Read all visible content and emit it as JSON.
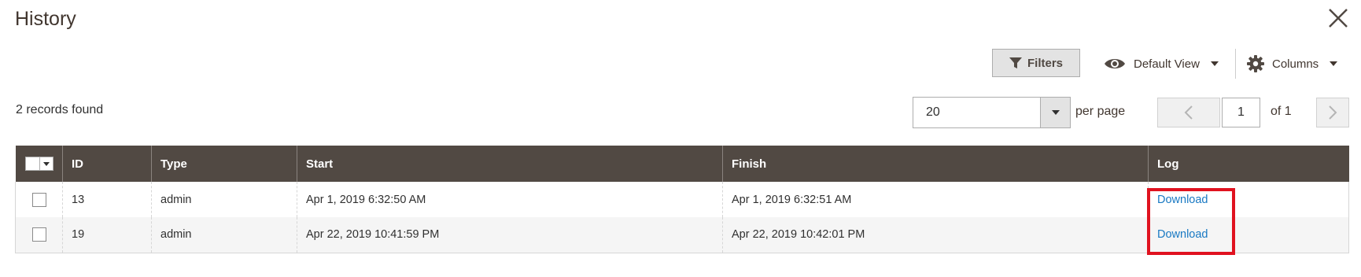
{
  "modal": {
    "title": "History"
  },
  "toolbar": {
    "filters_label": "Filters",
    "view_label": "Default View",
    "columns_label": "Columns"
  },
  "summary": {
    "records_text": "2 records found"
  },
  "pagination": {
    "per_page_value": "20",
    "per_page_label": "per page",
    "current_page": "1",
    "of_text": "of 1"
  },
  "grid": {
    "columns": [
      "ID",
      "Type",
      "Start",
      "Finish",
      "Log"
    ],
    "rows": [
      {
        "id": "13",
        "type": "admin",
        "start": "Apr 1, 2019 6:32:50 AM",
        "finish": "Apr 1, 2019 6:32:51 AM",
        "log": "Download"
      },
      {
        "id": "19",
        "type": "admin",
        "start": "Apr 22, 2019 10:41:59 PM",
        "finish": "Apr 22, 2019 10:42:01 PM",
        "log": "Download"
      }
    ]
  },
  "colors": {
    "header_bg": "#514943",
    "link": "#1979c3",
    "highlight": "#e0121f"
  },
  "icons": [
    "close-icon",
    "filter-icon",
    "eye-icon",
    "gear-icon",
    "chevron-left-icon",
    "chevron-right-icon"
  ]
}
